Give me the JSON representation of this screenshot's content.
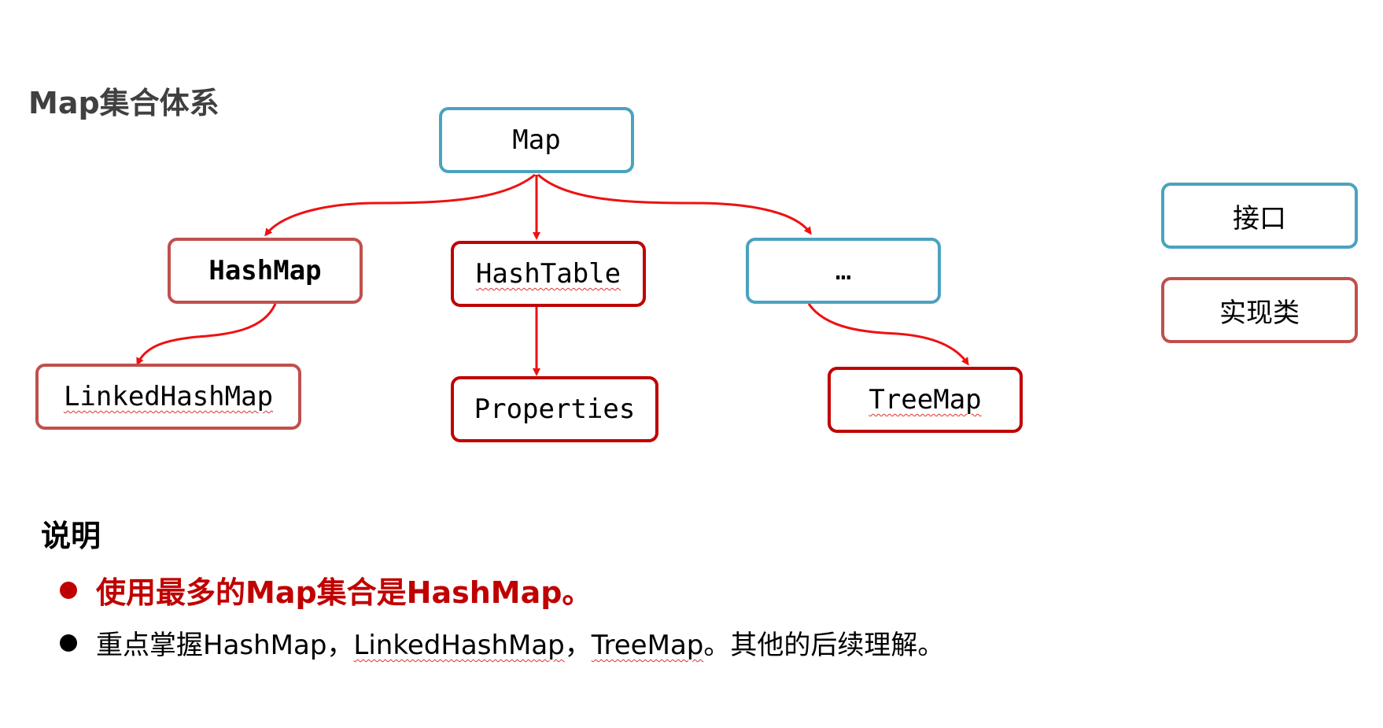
{
  "title": "Map集合体系",
  "nodes": {
    "map": "Map",
    "hashmap": "HashMap",
    "hashtable": "HashTable",
    "ellipsis": "…",
    "linkedhashmap": "LinkedHashMap",
    "properties": "Properties",
    "treemap": "TreeMap"
  },
  "legend": {
    "interface": "接口",
    "impl": "实现类"
  },
  "notes": {
    "heading": "说明",
    "line1": "使用最多的Map集合是HashMap。",
    "line2_prefix": "重点掌握HashMap，",
    "line2_linked": "LinkedHashMap",
    "line2_sep": "，",
    "line2_tree": "TreeMap",
    "line2_suffix": "。其他的后续理解。"
  },
  "colors": {
    "interface_border": "#4aa3bf",
    "impl_border": "#c00000",
    "arrow": "#ee1111",
    "highlight_text": "#c00000"
  }
}
